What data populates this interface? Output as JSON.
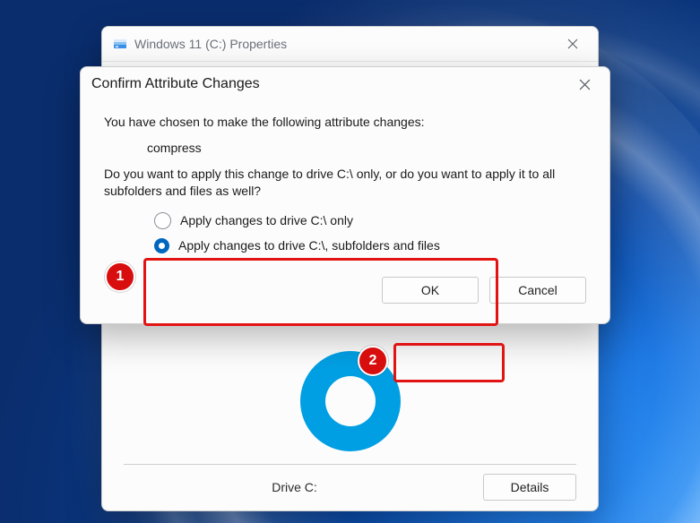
{
  "properties_window": {
    "title": "Windows 11 (C:) Properties",
    "drive_label": "Drive C:",
    "details_button": "Details"
  },
  "confirm_dialog": {
    "title": "Confirm Attribute Changes",
    "intro": "You have chosen to make the following attribute changes:",
    "change": "compress",
    "question": "Do you want to apply this change to drive C:\\ only, or do you want to apply it to all subfolders and files as well?",
    "option_only": "Apply changes to drive C:\\ only",
    "option_recursive": "Apply changes to drive C:\\, subfolders and files",
    "selected": "recursive",
    "ok": "OK",
    "cancel": "Cancel"
  },
  "annotations": {
    "step1": "1",
    "step2": "2"
  }
}
